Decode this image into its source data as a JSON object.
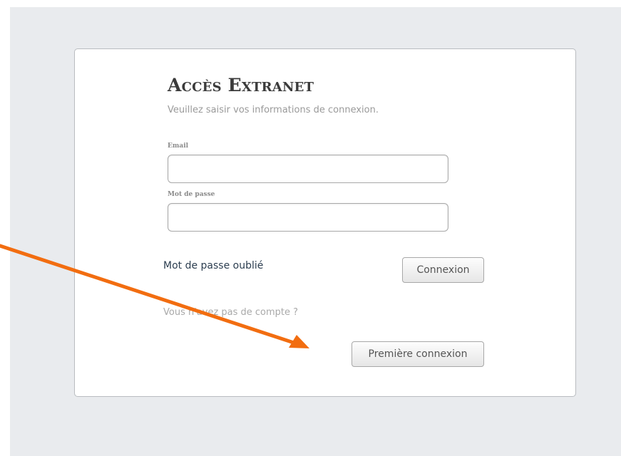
{
  "login": {
    "title": "Accès Extranet",
    "subtitle": "Veuillez saisir vos informations de connexion.",
    "email_label": "Email",
    "email_value": "",
    "password_label": "Mot de passe",
    "password_value": "",
    "forgot_password": "Mot de passe oublié",
    "connexion_button": "Connexion",
    "no_account_text": "Vous n'avez pas de compte ?",
    "first_connection_button": "Première connexion"
  },
  "annotation": {
    "arrow_color": "#f26d10",
    "icon": "arrow-icon"
  }
}
